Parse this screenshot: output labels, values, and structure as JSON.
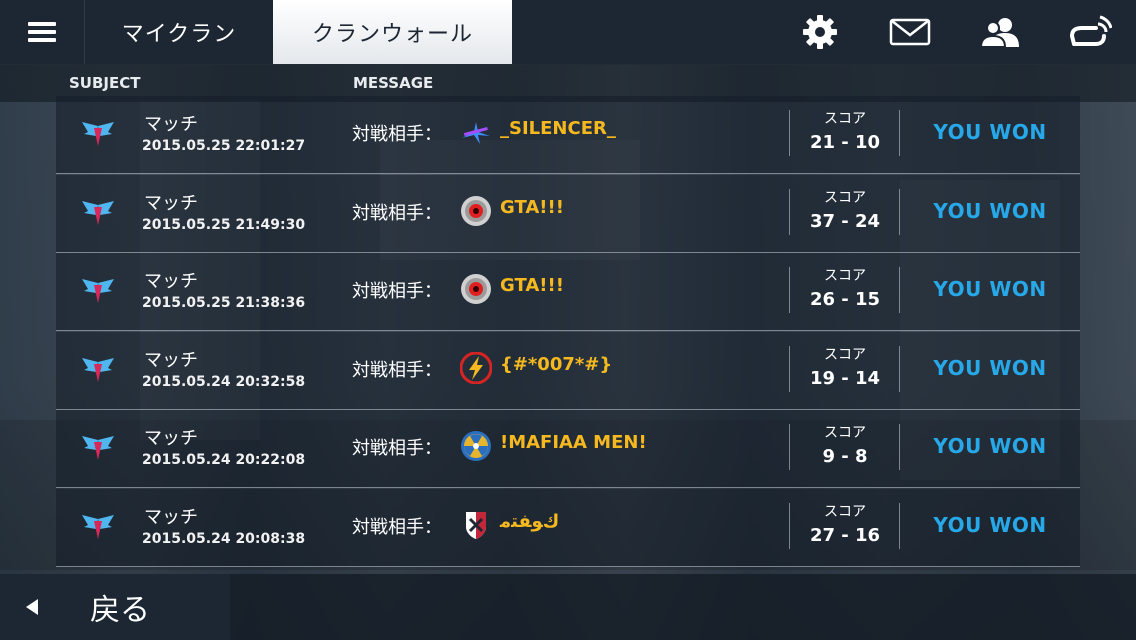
{
  "tabs": {
    "my_clan": "マイクラン",
    "clan_wall": "クランウォール"
  },
  "header": {
    "subject": "SUBJECT",
    "message": "MESSAGE"
  },
  "rows": [
    {
      "subject": "マッチ",
      "date": "2015.05.25 22:01:27",
      "vs_label": "対戦相手：",
      "clan": "_SILENCER_",
      "clan_icon": "rifle-icon",
      "score_label": "スコア",
      "score": "21 - 10",
      "result": "YOU WON"
    },
    {
      "subject": "マッチ",
      "date": "2015.05.25 21:49:30",
      "vs_label": "対戦相手：",
      "clan": "GTA!!!",
      "clan_icon": "sawblade-icon",
      "score_label": "スコア",
      "score": "37 - 24",
      "result": "YOU WON"
    },
    {
      "subject": "マッチ",
      "date": "2015.05.25 21:38:36",
      "vs_label": "対戦相手：",
      "clan": "GTA!!!",
      "clan_icon": "sawblade-icon",
      "score_label": "スコア",
      "score": "26 - 15",
      "result": "YOU WON"
    },
    {
      "subject": "マッチ",
      "date": "2015.05.24 20:32:58",
      "vs_label": "対戦相手：",
      "clan": "{#*007*#}",
      "clan_icon": "lightning-icon",
      "score_label": "スコア",
      "score": "19 - 14",
      "result": "YOU WON"
    },
    {
      "subject": "マッチ",
      "date": "2015.05.24 20:22:08",
      "vs_label": "対戦相手：",
      "clan": "!MAFIAA MEN!",
      "clan_icon": "radiation-icon",
      "score_label": "スコア",
      "score": "9 - 8",
      "result": "YOU WON"
    },
    {
      "subject": "マッチ",
      "date": "2015.05.24 20:08:38",
      "vs_label": "対戦相手：",
      "clan": "ﻙﻮﻔﺘﻣ",
      "clan_icon": "shield-icon",
      "score_label": "スコア",
      "score": "27 - 16",
      "result": "YOU WON"
    }
  ],
  "back_label": "戻る",
  "colors": {
    "accent_blue": "#27a8e8",
    "clan_gold": "#f5b91f",
    "bar_dark": "#1c2733"
  },
  "icons": {
    "menu": "hamburger-menu-icon",
    "settings": "gear-icon",
    "mail": "envelope-icon",
    "friends": "people-icon",
    "network": "gameloft-live-icon"
  }
}
